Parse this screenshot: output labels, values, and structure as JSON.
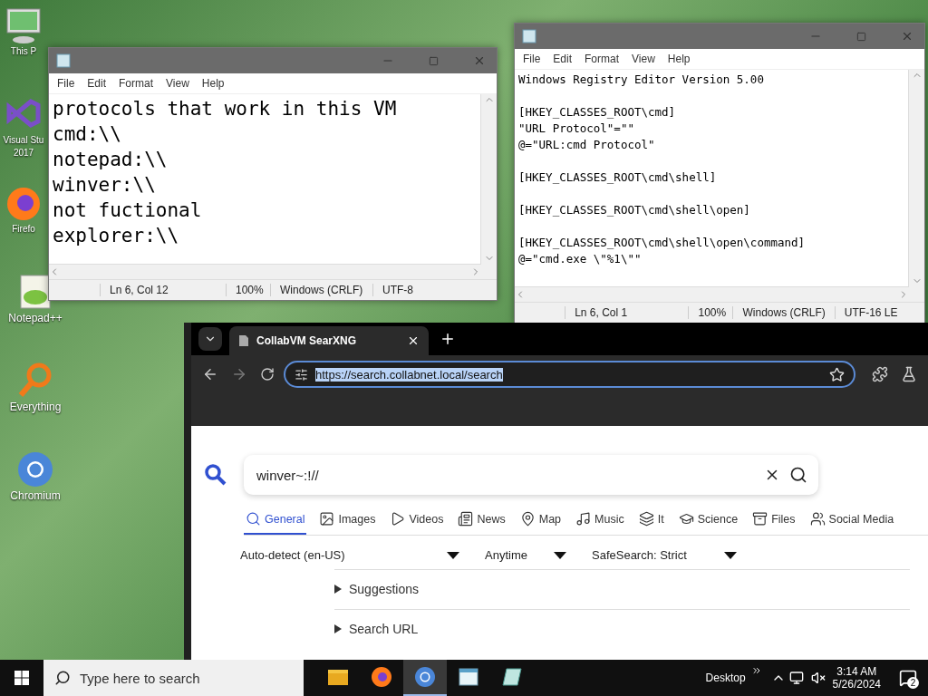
{
  "desktop_icons": [
    {
      "kind": "pc",
      "lines": [
        "This P"
      ]
    },
    {
      "kind": "vs",
      "lines": [
        "Visual Stu",
        "2017"
      ]
    },
    {
      "kind": "firefox",
      "lines": [
        "Firefo"
      ]
    },
    {
      "kind": "notepadpp",
      "lines": [
        "Notepad++"
      ]
    },
    {
      "kind": "everything",
      "lines": [
        "Everything"
      ]
    },
    {
      "kind": "chromium",
      "lines": [
        "Chromium"
      ]
    }
  ],
  "notepads": [
    {
      "menu": [
        "File",
        "Edit",
        "Format",
        "View",
        "Help"
      ],
      "large": true,
      "blocks": [
        [
          "protocols that work in this VM",
          "cmd:\\\\",
          "notepad:\\\\",
          "winver:\\\\",
          "not fuctional",
          "explorer:\\\\"
        ]
      ],
      "status": [
        "Ln 6, Col 12",
        "100%",
        "Windows (CRLF)",
        "UTF-8"
      ]
    },
    {
      "menu": [
        "File",
        "Edit",
        "Format",
        "View",
        "Help"
      ],
      "large": false,
      "blocks": [
        [
          "Windows Registry Editor Version 5.00"
        ],
        [
          "[HKEY_CLASSES_ROOT\\cmd]",
          "\"URL Protocol\"=\"\"",
          "@=\"URL:cmd Protocol\""
        ],
        [
          "[HKEY_CLASSES_ROOT\\cmd\\shell]"
        ],
        [
          "[HKEY_CLASSES_ROOT\\cmd\\shell\\open]"
        ],
        [
          "[HKEY_CLASSES_ROOT\\cmd\\shell\\open\\command]",
          "@=\"cmd.exe \\\"%1\\\"\""
        ]
      ],
      "status": [
        "Ln 6, Col 1",
        "100%",
        "Windows (CRLF)",
        "UTF-16 LE"
      ]
    }
  ],
  "browser": {
    "tab_title": "CollabVM SearXNG",
    "url": "https://search.collabnet.local/search",
    "query": "winver~:!//",
    "categories": [
      {
        "kind": "general",
        "label": "General",
        "selected": true
      },
      {
        "kind": "images",
        "label": "Images",
        "selected": false
      },
      {
        "kind": "videos",
        "label": "Videos",
        "selected": false
      },
      {
        "kind": "news",
        "label": "News",
        "selected": false
      },
      {
        "kind": "map",
        "label": "Map",
        "selected": false
      },
      {
        "kind": "music",
        "label": "Music",
        "selected": false
      },
      {
        "kind": "it",
        "label": "It",
        "selected": false
      },
      {
        "kind": "science",
        "label": "Science",
        "selected": false
      },
      {
        "kind": "files",
        "label": "Files",
        "selected": false
      },
      {
        "kind": "social",
        "label": "Social Media",
        "selected": false
      }
    ],
    "filters": [
      "Auto-detect (en-US)",
      "Anytime",
      "SafeSearch: Strict"
    ],
    "sections": [
      "Suggestions",
      "Search URL"
    ]
  },
  "taskbar": {
    "search_placeholder": "Type here to search",
    "apps": [
      {
        "kind": "explorer",
        "selected": false
      },
      {
        "kind": "firefox",
        "selected": false
      },
      {
        "kind": "chromium",
        "selected": true
      },
      {
        "kind": "notepad",
        "selected": false
      },
      {
        "kind": "notepad2",
        "selected": false
      }
    ],
    "toolbar": "Desktop",
    "time": "3:14 AM",
    "date": "5/26/2024",
    "notifications": "2"
  }
}
